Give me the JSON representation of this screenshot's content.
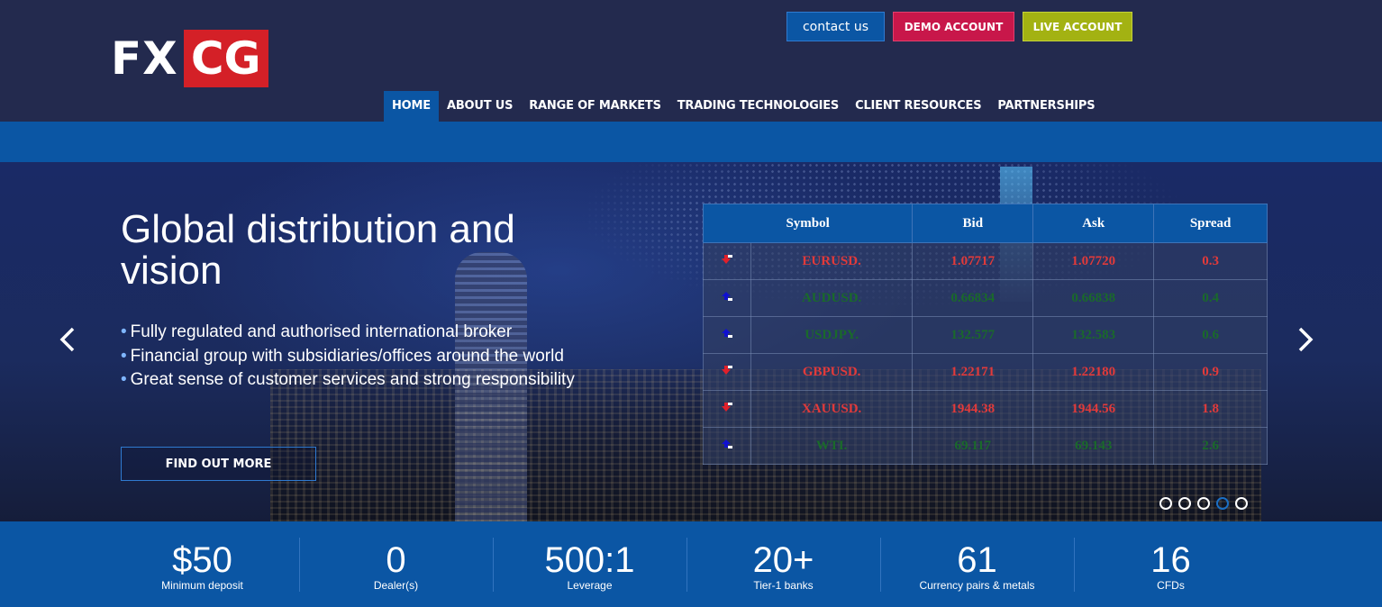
{
  "header": {
    "logo_left": "FX",
    "logo_right": "CG",
    "contact_label": "contact us",
    "demo_label": "DEMO ACCOUNT",
    "live_label": "LIVE ACCOUNT"
  },
  "nav": {
    "items": [
      "HOME",
      "ABOUT US",
      "RANGE OF MARKETS",
      "TRADING TECHNOLOGIES",
      "CLIENT RESOURCES",
      "PARTNERSHIPS"
    ],
    "active": "HOME"
  },
  "hero": {
    "title": "Global distribution and vision",
    "bullets": [
      "Fully regulated and authorised international broker",
      "Financial group with subsidiaries/offices around the world",
      "Great sense of customer services and strong responsibility"
    ],
    "cta_label": "FIND OUT MORE",
    "prev_icon": "chevron-left-icon",
    "next_icon": "chevron-right-icon",
    "slides_count": 5,
    "active_slide": 4
  },
  "rates": {
    "headers": [
      "Symbol",
      "Bid",
      "Ask",
      "Spread"
    ],
    "rows": [
      {
        "direction": "down",
        "symbol": "EURUSD.",
        "bid": "1.07717",
        "ask": "1.07720",
        "spread": "0.3"
      },
      {
        "direction": "up",
        "symbol": "AUDUSD.",
        "bid": "0.66834",
        "ask": "0.66838",
        "spread": "0.4"
      },
      {
        "direction": "up",
        "symbol": "USDJPY.",
        "bid": "132.577",
        "ask": "132.583",
        "spread": "0.6"
      },
      {
        "direction": "down",
        "symbol": "GBPUSD.",
        "bid": "1.22171",
        "ask": "1.22180",
        "spread": "0.9"
      },
      {
        "direction": "down",
        "symbol": "XAUUSD.",
        "bid": "1944.38",
        "ask": "1944.56",
        "spread": "1.8"
      },
      {
        "direction": "up",
        "symbol": "WTI.",
        "bid": "69.117",
        "ask": "69.143",
        "spread": "2.6"
      }
    ]
  },
  "stats": [
    {
      "value": "$50",
      "label": "Minimum deposit"
    },
    {
      "value": "0",
      "label": "Dealer(s)"
    },
    {
      "value": "500:1",
      "label": "Leverage"
    },
    {
      "value": "20+",
      "label": "Tier-1 banks"
    },
    {
      "value": "61",
      "label": "Currency pairs & metals"
    },
    {
      "value": "16",
      "label": "CFDs"
    }
  ],
  "colors": {
    "header_bg": "#232a4e",
    "brand_blue": "#0b56a4",
    "logo_red": "#d42027",
    "demo_red": "#c8174a",
    "live_green": "#a3b212",
    "price_down": "#e23a3a",
    "price_up": "#1a6a2a",
    "arrow_down": "#e0202a",
    "arrow_up": "#1010d0"
  }
}
